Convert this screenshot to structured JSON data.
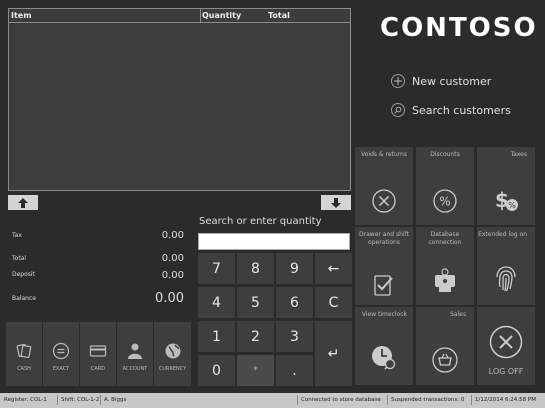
{
  "grid": {
    "columns": [
      "Item",
      "Quantity",
      "Total"
    ],
    "rows": []
  },
  "totals": {
    "tax_label": "Tax",
    "tax_value": "0.00",
    "total_label": "Total",
    "total_value": "0.00",
    "deposit_label": "Deposit",
    "deposit_value": "0.00",
    "balance_label": "Balance",
    "balance_value": "0.00"
  },
  "payments": [
    {
      "label": "CASH",
      "icon": "cash-icon"
    },
    {
      "label": "EXACT",
      "icon": "exact-icon"
    },
    {
      "label": "CARD",
      "icon": "card-icon"
    },
    {
      "label": "ACCOUNT",
      "icon": "account-icon"
    },
    {
      "label": "CURRENCY",
      "icon": "currency-icon"
    }
  ],
  "search": {
    "label": "Search or enter quantity",
    "value": "",
    "placeholder": ""
  },
  "keypad": {
    "keys": [
      "7",
      "8",
      "9",
      "4",
      "5",
      "6",
      "1",
      "2",
      "3",
      "0",
      "*",
      "."
    ],
    "backspace_label": "←",
    "clear_label": "C",
    "enter_label": "↵"
  },
  "brand": {
    "logo": "CONTOSO"
  },
  "customer": {
    "new_label": "New customer",
    "search_label": "Search customers"
  },
  "tiles": {
    "voids": "Voids & returns",
    "discounts": "Discounts",
    "taxes": "Taxes",
    "drawer": "Drawer and shift operations",
    "database": "Database connection",
    "extended_logon": "Extended log on",
    "view_timeclock": "View timeclock",
    "sales": "Sales",
    "logoff": "LOG OFF"
  },
  "status_bar": {
    "register": "Register: COL-1",
    "shift": "Shift: COL-1-2",
    "user": "A. Biggs",
    "connection": "Connected to store database",
    "suspended": "Suspended transactions: 0",
    "datetime": "1/12/2014 6:24:58 PM"
  },
  "colors": {
    "background": "#2b2b2b",
    "tile": "#3e3e3e",
    "grid": "#3c3c3c",
    "status_bar": "#c8c8c8"
  }
}
